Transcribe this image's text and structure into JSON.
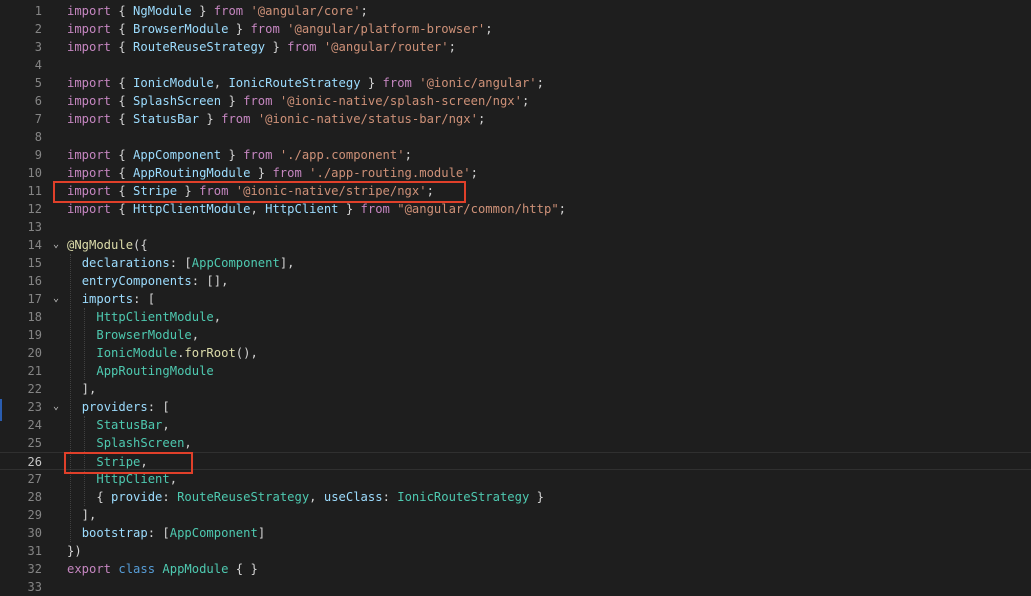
{
  "editor": {
    "lines": [
      {
        "n": "1",
        "tokens": [
          [
            "kw2",
            "import"
          ],
          [
            "plain",
            " { "
          ],
          [
            "id",
            "NgModule"
          ],
          [
            "plain",
            " } "
          ],
          [
            "kw2",
            "from"
          ],
          [
            "plain",
            " "
          ],
          [
            "str",
            "'@angular/core'"
          ],
          [
            "plain",
            ";"
          ]
        ]
      },
      {
        "n": "2",
        "tokens": [
          [
            "kw2",
            "import"
          ],
          [
            "plain",
            " { "
          ],
          [
            "id",
            "BrowserModule"
          ],
          [
            "plain",
            " } "
          ],
          [
            "kw2",
            "from"
          ],
          [
            "plain",
            " "
          ],
          [
            "str",
            "'@angular/platform-browser'"
          ],
          [
            "plain",
            ";"
          ]
        ]
      },
      {
        "n": "3",
        "tokens": [
          [
            "kw2",
            "import"
          ],
          [
            "plain",
            " { "
          ],
          [
            "id",
            "RouteReuseStrategy"
          ],
          [
            "plain",
            " } "
          ],
          [
            "kw2",
            "from"
          ],
          [
            "plain",
            " "
          ],
          [
            "str",
            "'@angular/router'"
          ],
          [
            "plain",
            ";"
          ]
        ]
      },
      {
        "n": "4",
        "tokens": []
      },
      {
        "n": "5",
        "tokens": [
          [
            "kw2",
            "import"
          ],
          [
            "plain",
            " { "
          ],
          [
            "id",
            "IonicModule"
          ],
          [
            "plain",
            ", "
          ],
          [
            "id",
            "IonicRouteStrategy"
          ],
          [
            "plain",
            " } "
          ],
          [
            "kw2",
            "from"
          ],
          [
            "plain",
            " "
          ],
          [
            "str",
            "'@ionic/angular'"
          ],
          [
            "plain",
            ";"
          ]
        ]
      },
      {
        "n": "6",
        "tokens": [
          [
            "kw2",
            "import"
          ],
          [
            "plain",
            " { "
          ],
          [
            "id",
            "SplashScreen"
          ],
          [
            "plain",
            " } "
          ],
          [
            "kw2",
            "from"
          ],
          [
            "plain",
            " "
          ],
          [
            "str",
            "'@ionic-native/splash-screen/ngx'"
          ],
          [
            "plain",
            ";"
          ]
        ]
      },
      {
        "n": "7",
        "tokens": [
          [
            "kw2",
            "import"
          ],
          [
            "plain",
            " { "
          ],
          [
            "id",
            "StatusBar"
          ],
          [
            "plain",
            " } "
          ],
          [
            "kw2",
            "from"
          ],
          [
            "plain",
            " "
          ],
          [
            "str",
            "'@ionic-native/status-bar/ngx'"
          ],
          [
            "plain",
            ";"
          ]
        ]
      },
      {
        "n": "8",
        "tokens": []
      },
      {
        "n": "9",
        "tokens": [
          [
            "kw2",
            "import"
          ],
          [
            "plain",
            " { "
          ],
          [
            "id",
            "AppComponent"
          ],
          [
            "plain",
            " } "
          ],
          [
            "kw2",
            "from"
          ],
          [
            "plain",
            " "
          ],
          [
            "str",
            "'./app.component'"
          ],
          [
            "plain",
            ";"
          ]
        ]
      },
      {
        "n": "10",
        "tokens": [
          [
            "kw2",
            "import"
          ],
          [
            "plain",
            " { "
          ],
          [
            "id",
            "AppRoutingModule"
          ],
          [
            "plain",
            " } "
          ],
          [
            "kw2",
            "from"
          ],
          [
            "plain",
            " "
          ],
          [
            "str",
            "'./app-routing.module'"
          ],
          [
            "plain",
            ";"
          ]
        ]
      },
      {
        "n": "11",
        "tokens": [
          [
            "kw2",
            "import"
          ],
          [
            "plain",
            " { "
          ],
          [
            "id",
            "Stripe"
          ],
          [
            "plain",
            " } "
          ],
          [
            "kw2",
            "from"
          ],
          [
            "plain",
            " "
          ],
          [
            "str",
            "'@ionic-native/stripe/ngx'"
          ],
          [
            "plain",
            ";"
          ]
        ]
      },
      {
        "n": "12",
        "tokens": [
          [
            "kw2",
            "import"
          ],
          [
            "plain",
            " { "
          ],
          [
            "id",
            "HttpClientModule"
          ],
          [
            "plain",
            ", "
          ],
          [
            "id",
            "HttpClient"
          ],
          [
            "plain",
            " } "
          ],
          [
            "kw2",
            "from"
          ],
          [
            "plain",
            " "
          ],
          [
            "str",
            "\"@angular/common/http\""
          ],
          [
            "plain",
            ";"
          ]
        ]
      },
      {
        "n": "13",
        "tokens": []
      },
      {
        "n": "14",
        "tokens": [
          [
            "fn",
            "@NgModule"
          ],
          [
            "plain",
            "({"
          ]
        ]
      },
      {
        "n": "15",
        "tokens": [
          [
            "plain",
            "  "
          ],
          [
            "id",
            "declarations"
          ],
          [
            "plain",
            ": ["
          ],
          [
            "cls",
            "AppComponent"
          ],
          [
            "plain",
            "],"
          ]
        ]
      },
      {
        "n": "16",
        "tokens": [
          [
            "plain",
            "  "
          ],
          [
            "id",
            "entryComponents"
          ],
          [
            "plain",
            ": [],"
          ]
        ]
      },
      {
        "n": "17",
        "tokens": [
          [
            "plain",
            "  "
          ],
          [
            "id",
            "imports"
          ],
          [
            "plain",
            ": ["
          ]
        ]
      },
      {
        "n": "18",
        "tokens": [
          [
            "plain",
            "    "
          ],
          [
            "cls",
            "HttpClientModule"
          ],
          [
            "plain",
            ","
          ]
        ]
      },
      {
        "n": "19",
        "tokens": [
          [
            "plain",
            "    "
          ],
          [
            "cls",
            "BrowserModule"
          ],
          [
            "plain",
            ","
          ]
        ]
      },
      {
        "n": "20",
        "tokens": [
          [
            "plain",
            "    "
          ],
          [
            "cls",
            "IonicModule"
          ],
          [
            "plain",
            "."
          ],
          [
            "fn",
            "forRoot"
          ],
          [
            "plain",
            "(),"
          ]
        ]
      },
      {
        "n": "21",
        "tokens": [
          [
            "plain",
            "    "
          ],
          [
            "cls",
            "AppRoutingModule"
          ]
        ]
      },
      {
        "n": "22",
        "tokens": [
          [
            "plain",
            "  ],"
          ]
        ]
      },
      {
        "n": "23",
        "tokens": [
          [
            "plain",
            "  "
          ],
          [
            "id",
            "providers"
          ],
          [
            "plain",
            ": ["
          ]
        ]
      },
      {
        "n": "24",
        "tokens": [
          [
            "plain",
            "    "
          ],
          [
            "cls",
            "StatusBar"
          ],
          [
            "plain",
            ","
          ]
        ]
      },
      {
        "n": "25",
        "tokens": [
          [
            "plain",
            "    "
          ],
          [
            "cls",
            "SplashScreen"
          ],
          [
            "plain",
            ","
          ]
        ]
      },
      {
        "n": "26",
        "tokens": [
          [
            "plain",
            "    "
          ],
          [
            "cls",
            "Stripe"
          ],
          [
            "plain",
            ","
          ]
        ]
      },
      {
        "n": "27",
        "tokens": [
          [
            "plain",
            "    "
          ],
          [
            "cls",
            "HttpClient"
          ],
          [
            "plain",
            ","
          ]
        ]
      },
      {
        "n": "28",
        "tokens": [
          [
            "plain",
            "    { "
          ],
          [
            "id",
            "provide"
          ],
          [
            "plain",
            ": "
          ],
          [
            "cls",
            "RouteReuseStrategy"
          ],
          [
            "plain",
            ", "
          ],
          [
            "id",
            "useClass"
          ],
          [
            "plain",
            ": "
          ],
          [
            "cls",
            "IonicRouteStrategy"
          ],
          [
            "plain",
            " }"
          ]
        ]
      },
      {
        "n": "29",
        "tokens": [
          [
            "plain",
            "  ],"
          ]
        ]
      },
      {
        "n": "30",
        "tokens": [
          [
            "plain",
            "  "
          ],
          [
            "id",
            "bootstrap"
          ],
          [
            "plain",
            ": ["
          ],
          [
            "cls",
            "AppComponent"
          ],
          [
            "plain",
            "]"
          ]
        ]
      },
      {
        "n": "31",
        "tokens": [
          [
            "plain",
            "})"
          ]
        ]
      },
      {
        "n": "32",
        "tokens": [
          [
            "kw2",
            "export"
          ],
          [
            "plain",
            " "
          ],
          [
            "kw",
            "class"
          ],
          [
            "plain",
            " "
          ],
          [
            "cls",
            "AppModule"
          ],
          [
            "plain",
            " { }"
          ]
        ]
      },
      {
        "n": "33",
        "tokens": []
      }
    ],
    "current_line": "26",
    "fold_lines": [
      "14",
      "17",
      "23"
    ],
    "fold_icon": "chevron-down-icon",
    "highlight_color": "#e0402a"
  }
}
